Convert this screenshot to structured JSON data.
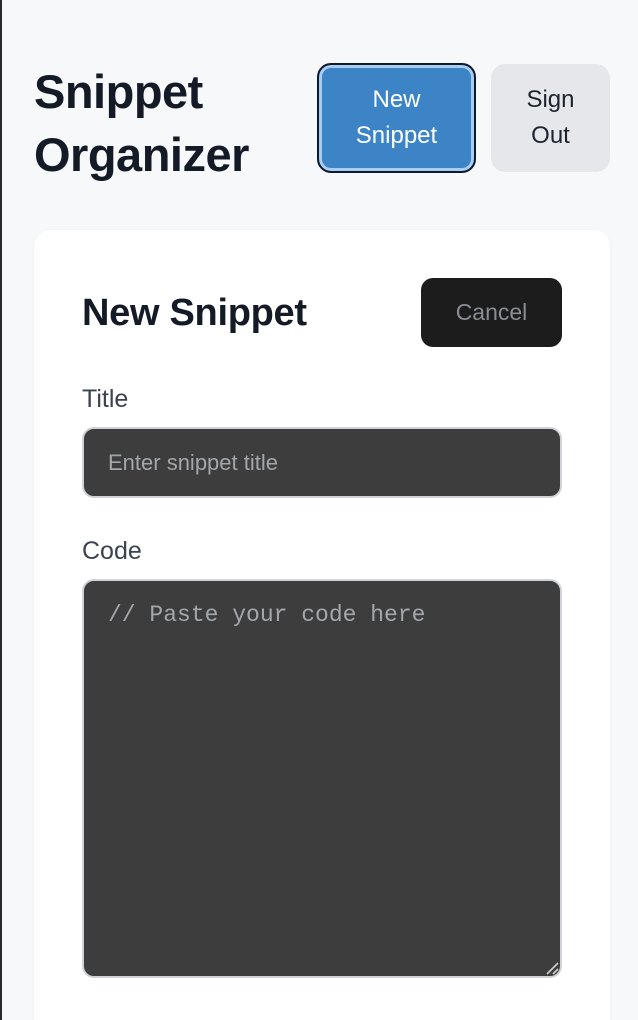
{
  "header": {
    "app_title": "Snippet Organizer",
    "new_snippet_label": "New Snippet",
    "sign_out_label": "Sign Out"
  },
  "form": {
    "title": "New Snippet",
    "cancel_label": "Cancel",
    "title_field": {
      "label": "Title",
      "value": "",
      "placeholder": "Enter snippet title"
    },
    "code_field": {
      "label": "Code",
      "value": "",
      "placeholder": "// Paste your code here"
    }
  },
  "icons": {
    "resize_handle": "resize-grip-icon"
  },
  "colors": {
    "primary_button": "#3c84c6",
    "secondary_button": "#e5e7ea",
    "cancel_button": "#1c1c1c",
    "input_background": "#3d3d3d",
    "page_background": "#f7f8fa"
  }
}
